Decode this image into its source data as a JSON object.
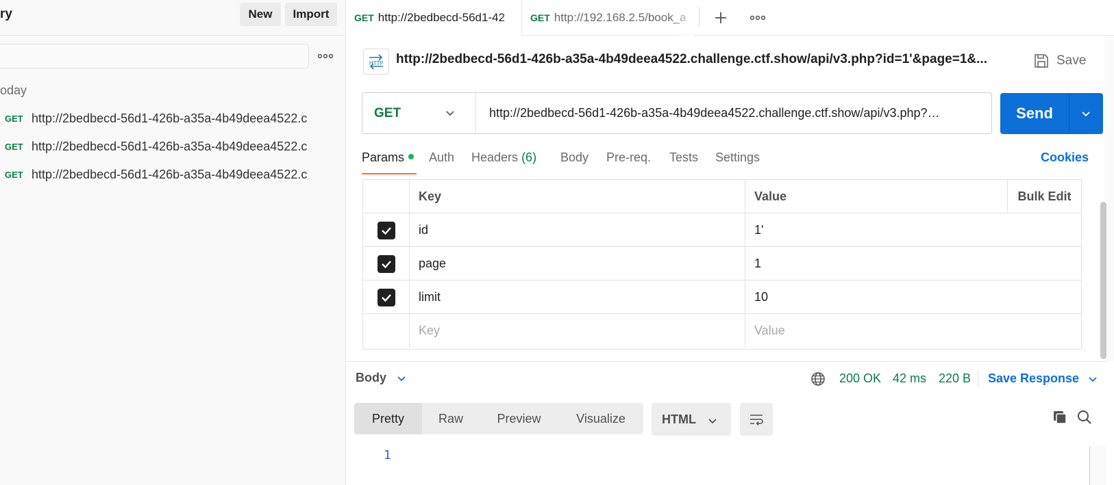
{
  "sidebar": {
    "title": "ry",
    "new_label": "New",
    "import_label": "Import",
    "group_label": "oday",
    "history": [
      {
        "method": "GET",
        "url": "http://2bedbecd-56d1-426b-a35a-4b49deea4522.c"
      },
      {
        "method": "GET",
        "url": "http://2bedbecd-56d1-426b-a35a-4b49deea4522.c"
      },
      {
        "method": "GET",
        "url": "http://2bedbecd-56d1-426b-a35a-4b49deea4522.c"
      }
    ]
  },
  "tabs": [
    {
      "method": "GET",
      "url": "http://2bedbecd-56d1-42",
      "active": true
    },
    {
      "method": "GET",
      "url": "http://192.168.2.5/book_a",
      "active": false
    }
  ],
  "request": {
    "icon_text": "HTTP",
    "title": "http://2bedbecd-56d1-426b-a35a-4b49deea4522.challenge.ctf.show/api/v3.php?id=1'&page=1&...",
    "save_label": "Save",
    "method": "GET",
    "url": "http://2bedbecd-56d1-426b-a35a-4b49deea4522.challenge.ctf.show/api/v3.php?…",
    "send_label": "Send"
  },
  "request_tabs": {
    "params": "Params",
    "auth": "Auth",
    "headers": "Headers",
    "headers_count": "(6)",
    "body": "Body",
    "prereq": "Pre-req.",
    "tests": "Tests",
    "settings": "Settings",
    "cookies": "Cookies"
  },
  "params_table": {
    "key_header": "Key",
    "value_header": "Value",
    "bulk_edit": "Bulk Edit",
    "rows": [
      {
        "key": "id",
        "value": "1'",
        "checked": true
      },
      {
        "key": "page",
        "value": "1",
        "checked": true
      },
      {
        "key": "limit",
        "value": "10",
        "checked": true
      }
    ],
    "key_placeholder": "Key",
    "value_placeholder": "Value"
  },
  "response": {
    "body_label": "Body",
    "status": "200 OK",
    "time": "42 ms",
    "size": "220 B",
    "save_response": "Save Response",
    "views": [
      "Pretty",
      "Raw",
      "Preview",
      "Visualize"
    ],
    "active_view": "Pretty",
    "format": "HTML",
    "line_number": "1"
  },
  "colors": {
    "accent_blue": "#0c6fd8",
    "method_green": "#0b7d44",
    "tab_underline": "#ff6c37",
    "status_green": "#0b7d44"
  }
}
